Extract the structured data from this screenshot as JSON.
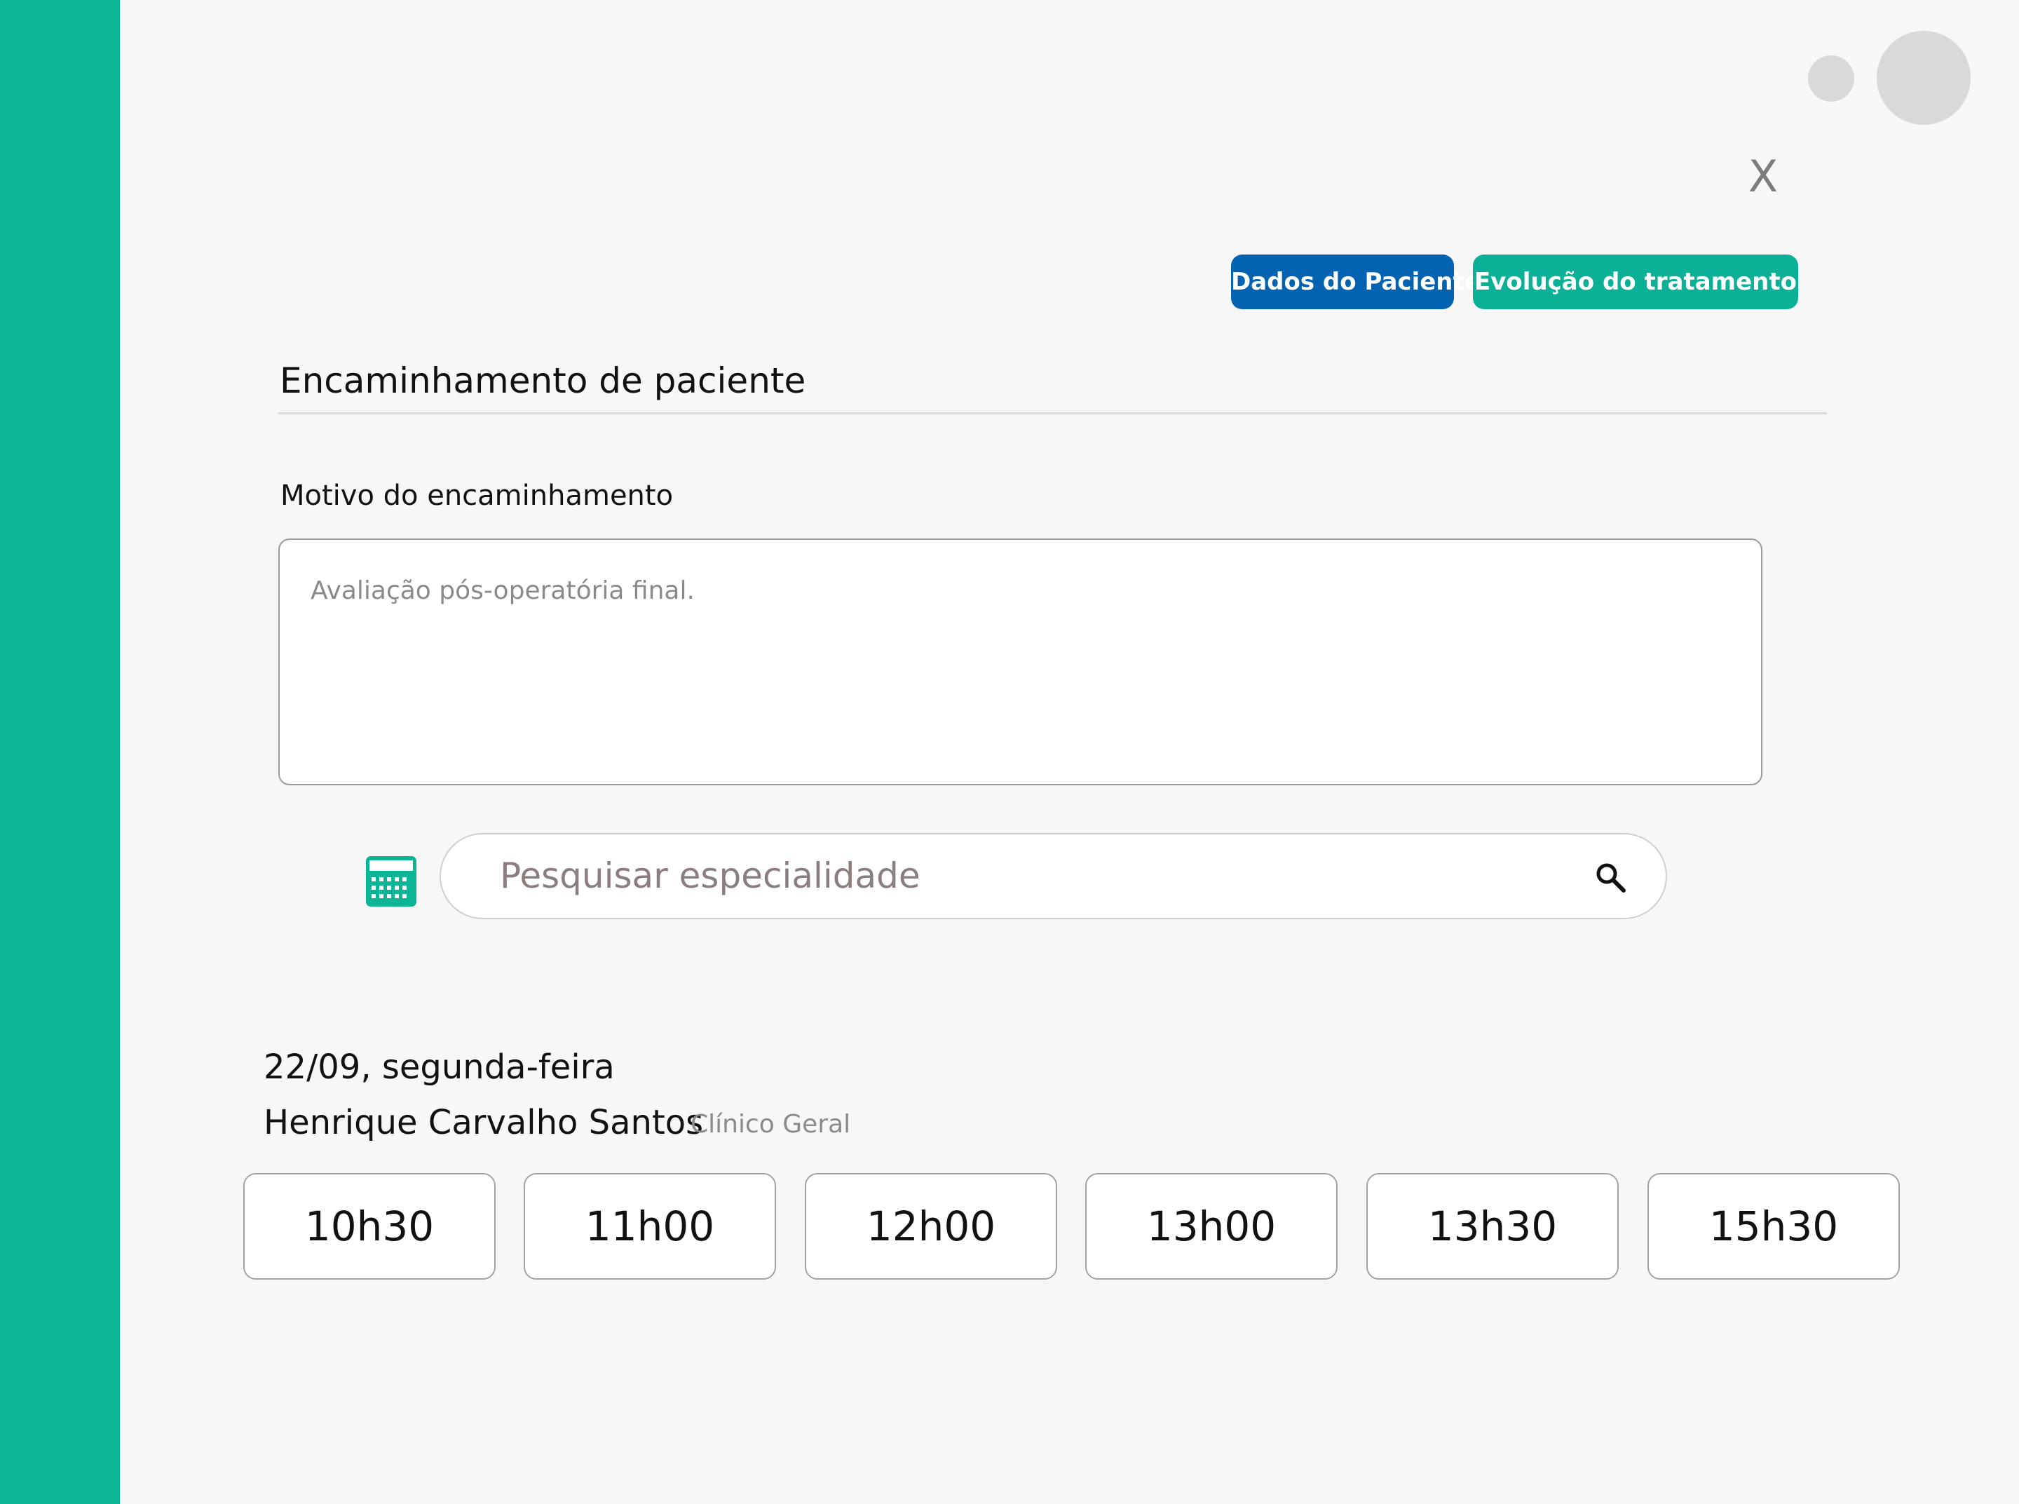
{
  "colors": {
    "accent": "#0cb695",
    "primary_button": "#0463b0",
    "secondary_button": "#0cb097"
  },
  "header": {
    "close_label": "X"
  },
  "actions": {
    "patient_data_label": "Dados do Paciente",
    "treatment_evolution_label": "Evolução do tratamento"
  },
  "form": {
    "title": "Encaminhamento de paciente",
    "reason_label": "Motivo do encaminhamento",
    "reason_value": "Avaliação pós-operatória final."
  },
  "search": {
    "placeholder": "Pesquisar especialidade",
    "calendar_icon": "calendar-icon",
    "search_icon": "search-icon"
  },
  "schedule": {
    "date": "22/09, segunda-feira",
    "doctor_name": "Henrique Carvalho Santos",
    "specialty": "Clínico Geral",
    "slots": [
      "10h30",
      "11h00",
      "12h00",
      "13h00",
      "13h30",
      "15h30"
    ]
  }
}
